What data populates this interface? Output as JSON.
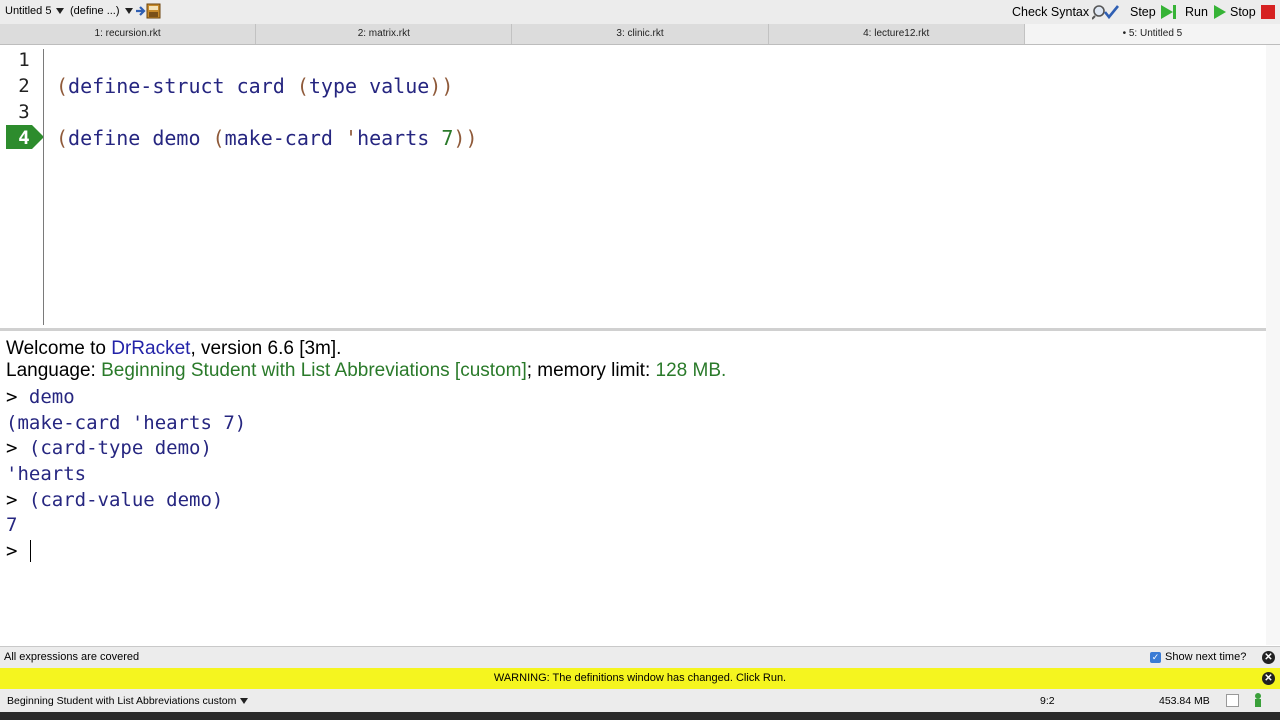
{
  "toolbar": {
    "file_menu": "Untitled 5",
    "define_menu": "(define ...)",
    "check_syntax": "Check Syntax",
    "step": "Step",
    "run": "Run",
    "stop": "Stop"
  },
  "tabs": [
    {
      "label": "1: recursion.rkt"
    },
    {
      "label": "2: matrix.rkt"
    },
    {
      "label": "3: clinic.rkt"
    },
    {
      "label": "4: lecture12.rkt"
    },
    {
      "label": "• 5: Untitled 5"
    }
  ],
  "definitions": {
    "line_numbers": [
      "1",
      "2",
      "3",
      "4"
    ],
    "current_line": "4",
    "line2": {
      "open": "(",
      "kw": "define-struct card ",
      "open2": "(",
      "fields": "type value",
      "close": "))"
    },
    "line4": {
      "open": "(",
      "kw": "define demo ",
      "open2": "(",
      "call": "make-card ",
      "quote": "'",
      "sym": "hearts",
      "space": " ",
      "num": "7",
      "close": "))"
    }
  },
  "interactions": {
    "welcome_prefix": "Welcome to ",
    "app_name": "DrRacket",
    "welcome_suffix": ", version 6.6 [3m].",
    "language_prefix": "Language: ",
    "language": "Beginning Student with List Abbreviations [custom]",
    "memory_prefix": "; memory limit: ",
    "memory": "128 MB",
    "memory_suffix": ".",
    "prompt": ">",
    "entries": [
      {
        "input": " demo",
        "output": "(make-card 'hearts 7)"
      },
      {
        "input": " (card-type demo)",
        "output": "'hearts"
      },
      {
        "input": " (card-value demo)",
        "output": "7"
      }
    ]
  },
  "status": {
    "coverage": "All expressions are covered",
    "show_next_time": "Show next time?",
    "warning": "WARNING: The definitions window has changed. Click Run.",
    "language_menu": "Beginning Student with List Abbreviations custom",
    "position": "9:2",
    "memory": "453.84 MB"
  }
}
